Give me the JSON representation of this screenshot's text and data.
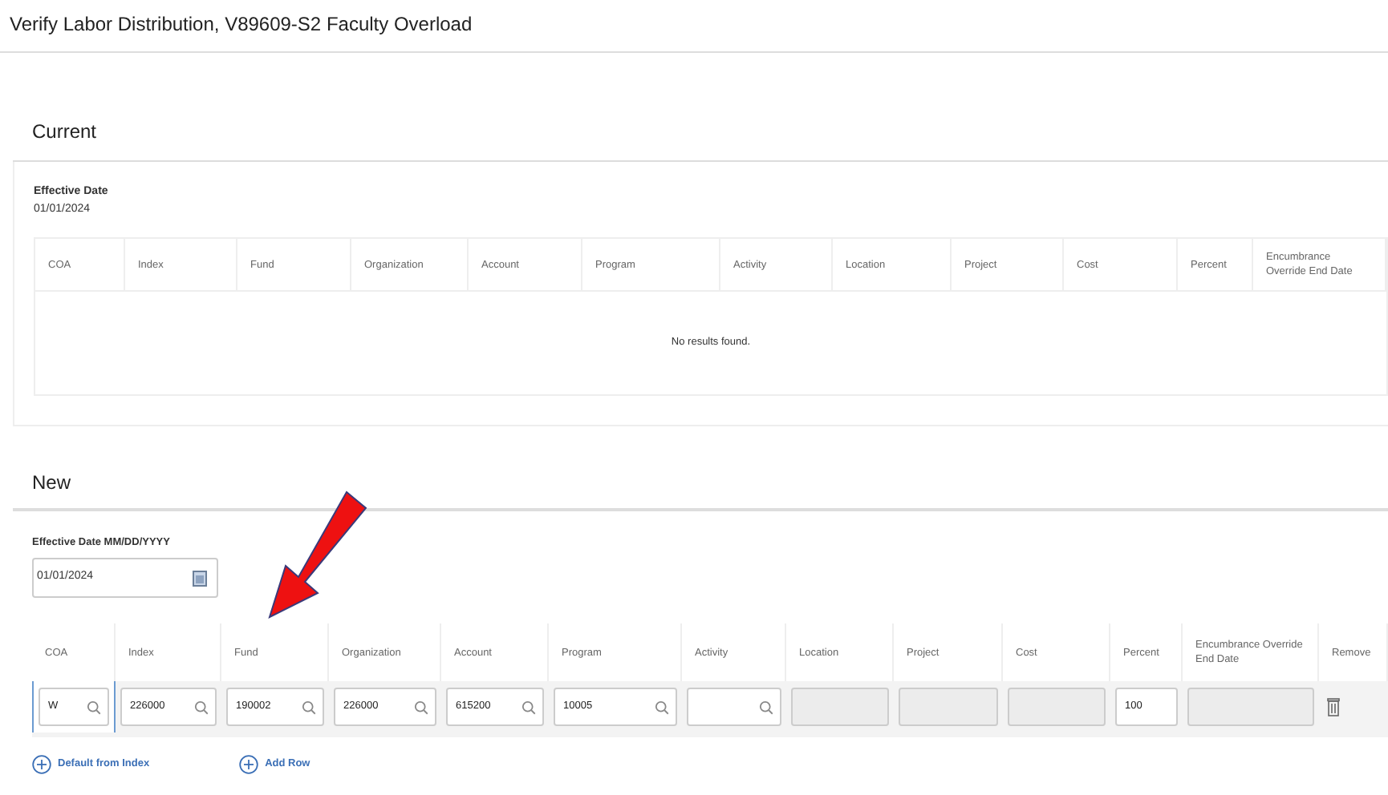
{
  "title": "Verify Labor Distribution, V89609-S2 Faculty Overload",
  "current": {
    "heading": "Current",
    "effective_date_label": "Effective Date",
    "effective_date": "01/01/2024",
    "columns": [
      "COA",
      "Index",
      "Fund",
      "Organization",
      "Account",
      "Program",
      "Activity",
      "Location",
      "Project",
      "Cost",
      "Percent",
      "Encumbrance Override End Date"
    ],
    "empty_message": "No results found."
  },
  "new": {
    "heading": "New",
    "date_label": "Effective Date MM/DD/YYYY",
    "date_value": "01/01/2024",
    "columns": [
      "COA",
      "Index",
      "Fund",
      "Organization",
      "Account",
      "Program",
      "Activity",
      "Location",
      "Project",
      "Cost",
      "Percent",
      "Encumbrance Override End Date",
      "Remove"
    ],
    "row": [
      {
        "kind": "lookup",
        "value": "W"
      },
      {
        "kind": "lookup",
        "value": "226000"
      },
      {
        "kind": "lookup",
        "value": "190002"
      },
      {
        "kind": "lookup",
        "value": "226000"
      },
      {
        "kind": "lookup",
        "value": "615200"
      },
      {
        "kind": "lookup",
        "value": "10005"
      },
      {
        "kind": "lookup"
      },
      {
        "kind": "disabled"
      },
      {
        "kind": "disabled"
      },
      {
        "kind": "disabled"
      },
      {
        "kind": "text",
        "value": "100"
      },
      {
        "kind": "disabled"
      },
      {
        "kind": "remove"
      }
    ],
    "actions": [
      "Default from Index",
      "Add Row"
    ]
  }
}
